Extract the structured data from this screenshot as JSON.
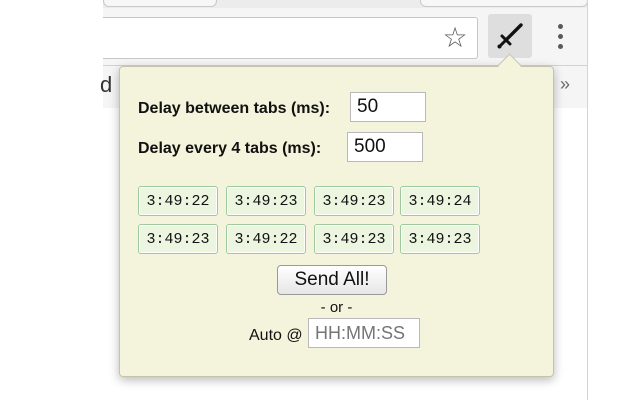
{
  "browser": {
    "bookmark_fragment": "d",
    "bookmarks_overflow": "»",
    "star_glyph": "☆",
    "extension_icon": "sword-icon",
    "menu_icon": "vertical-dots-icon"
  },
  "popup": {
    "delay_between_label": "Delay between tabs (ms):",
    "delay_between_value": "50",
    "delay_every_label": "Delay every 4 tabs (ms):",
    "delay_every_value": "500",
    "times": [
      [
        "3:49:22",
        "3:49:23",
        "3:49:23",
        "3:49:24"
      ],
      [
        "3:49:23",
        "3:49:22",
        "3:49:23",
        "3:49:23"
      ]
    ],
    "send_all_label": "Send All!",
    "or_text": "- or -",
    "auto_label": "Auto @",
    "auto_placeholder": "HH:MM:SS"
  },
  "colors": {
    "popup_background": "#f4f4dc",
    "time_cell_border": "#9dca9d",
    "time_cell_background": "#ecf5df"
  }
}
